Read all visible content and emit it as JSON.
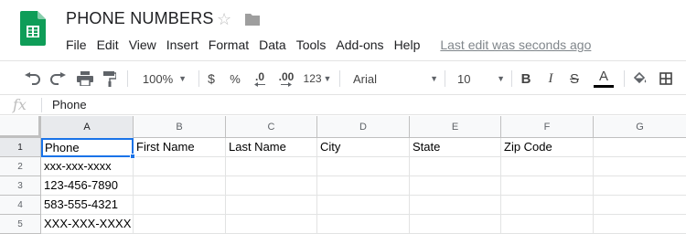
{
  "document": {
    "title": "PHONE NUMBERS",
    "star_icon": "star-outline-icon",
    "folder_icon": "folder-icon",
    "app_icon": "google-sheets-logo"
  },
  "menu": [
    "File",
    "Edit",
    "View",
    "Insert",
    "Format",
    "Data",
    "Tools",
    "Add-ons",
    "Help"
  ],
  "last_edit": "Last edit was seconds ago",
  "toolbar": {
    "zoom": "100%",
    "currency": "$",
    "percent": "%",
    "decrease_decimal": ".0",
    "increase_decimal": ".00",
    "more_formats": "123",
    "font": "Arial",
    "font_size": "10",
    "bold": "B",
    "italic": "I",
    "strikethrough": "S",
    "text_color": "A",
    "text_color_swatch": "#000000",
    "icons": [
      "undo-icon",
      "redo-icon",
      "print-icon",
      "paint-format-icon",
      "fill-color-icon",
      "borders-icon"
    ]
  },
  "formula_bar": {
    "fx": "fx",
    "value": "Phone"
  },
  "grid": {
    "columns": [
      "A",
      "B",
      "C",
      "D",
      "E",
      "F",
      "G"
    ],
    "rows": [
      "1",
      "2",
      "3",
      "4",
      "5"
    ],
    "cells": [
      [
        "Phone",
        "First Name",
        "Last Name",
        "City",
        "State",
        "Zip Code",
        ""
      ],
      [
        "xxx-xxx-xxxx",
        "",
        "",
        "",
        "",
        "",
        ""
      ],
      [
        "123-456-7890",
        "",
        "",
        "",
        "",
        "",
        ""
      ],
      [
        "583-555-4321",
        "",
        "",
        "",
        "",
        "",
        ""
      ],
      [
        "XXX-XXX-XXXX",
        "",
        "",
        "",
        "",
        "",
        ""
      ]
    ],
    "active_cell": "A1",
    "selection_color": "#1a73e8"
  }
}
